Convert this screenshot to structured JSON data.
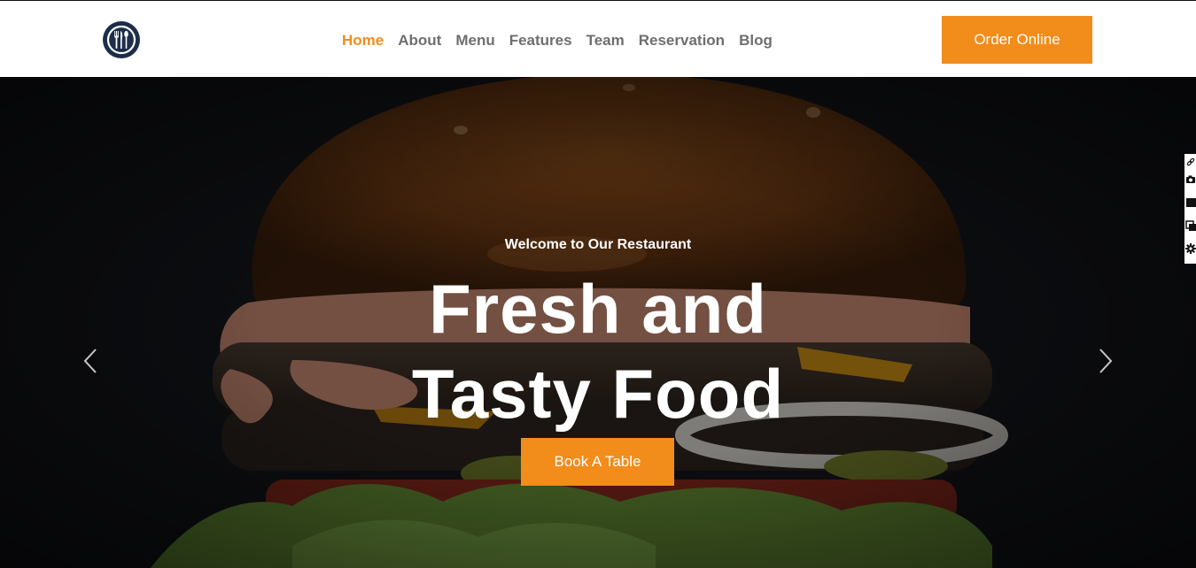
{
  "header": {
    "logo_icon": "fork-knife-spoon-icon",
    "nav": [
      {
        "label": "Home",
        "active": true
      },
      {
        "label": "About",
        "active": false
      },
      {
        "label": "Menu",
        "active": false
      },
      {
        "label": "Features",
        "active": false
      },
      {
        "label": "Team",
        "active": false
      },
      {
        "label": "Reservation",
        "active": false
      },
      {
        "label": "Blog",
        "active": false
      }
    ],
    "order_button": "Order Online"
  },
  "hero": {
    "welcome": "Welcome to Our Restaurant",
    "headline_line1": "Fresh and",
    "headline_line2": "Tasty Food",
    "book_button": "Book A Table",
    "prev_icon": "chevron-left-icon",
    "next_icon": "chevron-right-icon"
  },
  "side_tools": [
    "link-icon",
    "camera-icon",
    "square-icon",
    "copy-icon",
    "gear-icon"
  ],
  "colors": {
    "accent": "#f28c1b",
    "logo": "#1c2e4a",
    "nav_text": "#6f6f6f",
    "hero_bg": "#15171c"
  }
}
